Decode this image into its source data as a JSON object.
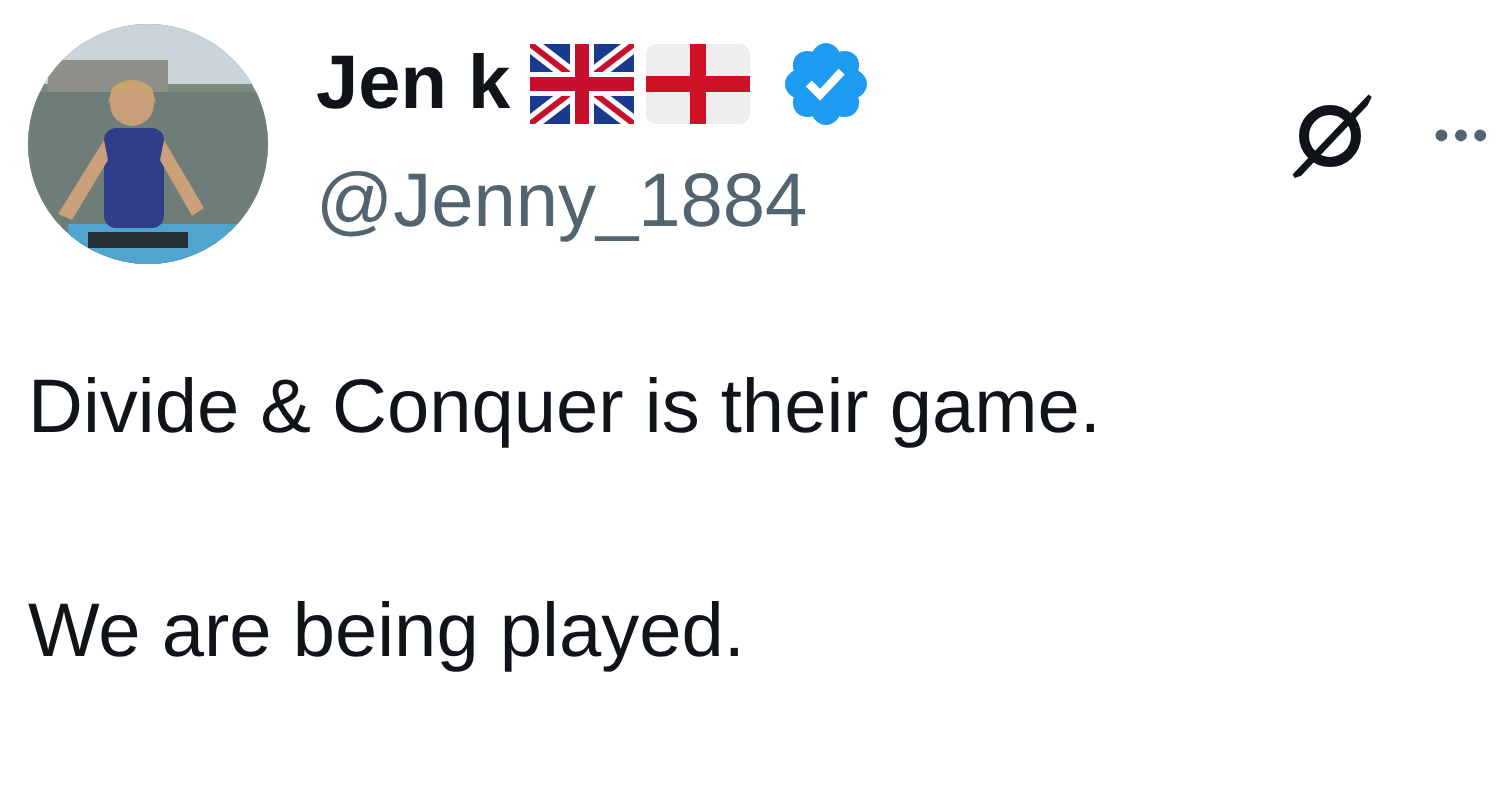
{
  "tweet": {
    "author": {
      "name": "Jen k",
      "handle": "@Jenny_1884",
      "verified": true
    },
    "more": "•••",
    "paragraphs": [
      "Divide & Conquer is their game.",
      "We are being played."
    ]
  }
}
